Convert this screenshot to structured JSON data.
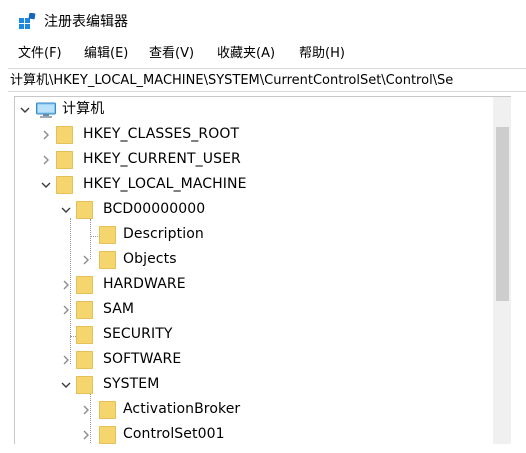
{
  "window": {
    "title": "注册表编辑器"
  },
  "menu": [
    {
      "label": "文件(F)"
    },
    {
      "label": "编辑(E)"
    },
    {
      "label": "查看(V)"
    },
    {
      "label": "收藏夹(A)"
    },
    {
      "label": "帮助(H)"
    }
  ],
  "address": {
    "path": "计算机\\HKEY_LOCAL_MACHINE\\SYSTEM\\CurrentControlSet\\Control\\Se"
  },
  "tree": {
    "root": {
      "label": "计算机",
      "expanded": true
    },
    "nodes": [
      {
        "label": "HKEY_CLASSES_ROOT",
        "depth": 1,
        "state": "collapsed"
      },
      {
        "label": "HKEY_CURRENT_USER",
        "depth": 1,
        "state": "collapsed"
      },
      {
        "label": "HKEY_LOCAL_MACHINE",
        "depth": 1,
        "state": "expanded"
      },
      {
        "label": "BCD00000000",
        "depth": 2,
        "state": "expanded"
      },
      {
        "label": "Description",
        "depth": 3,
        "state": "leaf"
      },
      {
        "label": "Objects",
        "depth": 3,
        "state": "collapsed"
      },
      {
        "label": "HARDWARE",
        "depth": 2,
        "state": "collapsed"
      },
      {
        "label": "SAM",
        "depth": 2,
        "state": "collapsed"
      },
      {
        "label": "SECURITY",
        "depth": 2,
        "state": "leaf"
      },
      {
        "label": "SOFTWARE",
        "depth": 2,
        "state": "collapsed"
      },
      {
        "label": "SYSTEM",
        "depth": 2,
        "state": "expanded"
      },
      {
        "label": "ActivationBroker",
        "depth": 3,
        "state": "collapsed"
      },
      {
        "label": "ControlSet001",
        "depth": 3,
        "state": "collapsed"
      }
    ]
  },
  "colors": {
    "folder": "#f5d66e",
    "folder_edge": "#e2b640",
    "chevron": "#8c8c8c",
    "chevron_expanded": "#3c3c3c",
    "icon_blue": "#1e88e5"
  }
}
